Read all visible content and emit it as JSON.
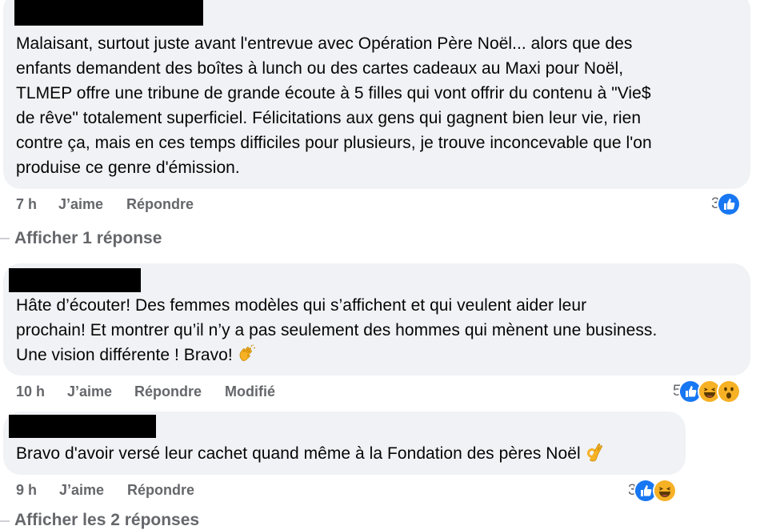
{
  "comments": [
    {
      "text_lines": [
        "Malaisant, surtout juste avant l'entrevue avec Opération Père Noël... alors que des",
        "enfants demandent des boîtes à lunch ou des cartes cadeaux au Maxi pour Noël,",
        "TLMEP offre une tribune de grande écoute à 5 filles qui vont offrir du contenu à \"Vie$",
        "de rêve\" totalement superficiel. Félicitations aux gens qui gagnent bien leur vie, rien",
        "contre ça, mais en ces temps difficiles pour plusieurs, je trouve inconcevable que l'on",
        "produise ce genre d'émission."
      ],
      "time": "7 h",
      "like_label": "J’aime",
      "reply_label": "Répondre",
      "reaction_count": "3",
      "reactions": [
        "like-icon"
      ],
      "view_replies": "Afficher 1 réponse"
    },
    {
      "text_lines": [
        "Hâte d’écouter! Des femmes modèles qui s’affichent et qui veulent aider leur",
        "prochain! Et montrer qu’il n’y a pas seulement des hommes qui mènent une business.",
        "Une vision différente ! Bravo!"
      ],
      "emoji": "clapping-hands-emoji",
      "time": "10 h",
      "like_label": "J’aime",
      "reply_label": "Répondre",
      "edited_label": "Modifié",
      "reaction_count": "5",
      "reactions": [
        "like-icon",
        "haha-icon",
        "wow-icon"
      ]
    },
    {
      "text_lines": [
        "Bravo d'avoir versé leur cachet quand même à la Fondation des pères Noël"
      ],
      "emoji": "ok-hand-emoji",
      "time": "9 h",
      "like_label": "J’aime",
      "reply_label": "Répondre",
      "reaction_count": "3",
      "reactions": [
        "like-icon",
        "haha-icon"
      ],
      "view_replies": "Afficher les 2 réponses"
    }
  ],
  "colors": {
    "bubble": "#f0f2f5",
    "meta": "#65676b",
    "like_blue": "#1877f2",
    "emoji_yellow": "#f7b125"
  }
}
